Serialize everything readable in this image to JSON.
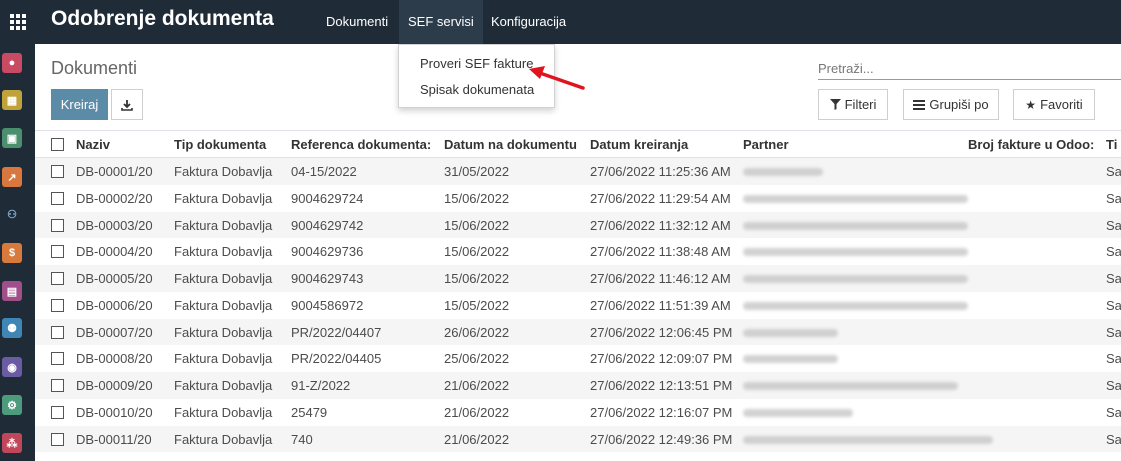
{
  "navbar": {
    "title": "Odobrenje dokumenta",
    "menu": [
      "Dokumenti",
      "SEF servisi",
      "Konfiguracija"
    ]
  },
  "dropdown": {
    "items": [
      "Proveri SEF fakture",
      "Spisak dokumenata"
    ]
  },
  "control_panel": {
    "breadcrumb": "Dokumenti",
    "create_label": "Kreiraj",
    "search_placeholder": "Pretraži...",
    "filters_label": "Filteri",
    "groupby_label": "Grupiši po",
    "favorites_label": "Favoriti"
  },
  "sidebar_icons": [
    "chat-icon",
    "calendar-icon",
    "contacts-icon",
    "chart-icon",
    "people-icon",
    "invoice-icon",
    "user-card-icon",
    "team-icon",
    "search-person-icon",
    "settings-user-icon",
    "network-icon"
  ],
  "table": {
    "columns": [
      "Naziv",
      "Tip dokumenta",
      "Referenca dokumenta:",
      "Datum na dokumentu",
      "Datum kreiranja",
      "Partner",
      "Broj fakture u Odoo:",
      "Ti"
    ],
    "rows": [
      [
        "DB-00001/20",
        "Faktura Dobavlja",
        "04-15/2022",
        "31/05/2022",
        "27/06/2022 11:25:36 AM",
        "Sa"
      ],
      [
        "DB-00002/20",
        "Faktura Dobavlja",
        "9004629724",
        "15/06/2022",
        "27/06/2022 11:29:54 AM",
        "Sa"
      ],
      [
        "DB-00003/20",
        "Faktura Dobavlja",
        "9004629742",
        "15/06/2022",
        "27/06/2022 11:32:12 AM",
        "Sa"
      ],
      [
        "DB-00004/20",
        "Faktura Dobavlja",
        "9004629736",
        "15/06/2022",
        "27/06/2022 11:38:48 AM",
        "Sa"
      ],
      [
        "DB-00005/20",
        "Faktura Dobavlja",
        "9004629743",
        "15/06/2022",
        "27/06/2022 11:46:12 AM",
        "Sa"
      ],
      [
        "DB-00006/20",
        "Faktura Dobavlja",
        "9004586972",
        "15/05/2022",
        "27/06/2022 11:51:39 AM",
        "Sa"
      ],
      [
        "DB-00007/20",
        "Faktura Dobavlja",
        "PR/2022/04407",
        "26/06/2022",
        "27/06/2022 12:06:45 PM",
        "Sa"
      ],
      [
        "DB-00008/20",
        "Faktura Dobavlja",
        "PR/2022/04405",
        "25/06/2022",
        "27/06/2022 12:09:07 PM",
        "Sa"
      ],
      [
        "DB-00009/20",
        "Faktura Dobavlja",
        "91-Z/2022",
        "21/06/2022",
        "27/06/2022 12:13:51 PM",
        "Sa"
      ],
      [
        "DB-00010/20",
        "Faktura Dobavlja",
        "25479",
        "21/06/2022",
        "27/06/2022 12:16:07 PM",
        "Sa"
      ],
      [
        "DB-00011/20",
        "Faktura Dobavlja",
        "740",
        "21/06/2022",
        "27/06/2022 12:49:36 PM",
        "Sa"
      ]
    ]
  },
  "colors": {
    "navbar_bg": "#1f2b37",
    "primary_button": "#5c8ba8",
    "arrow": "#e0141e"
  }
}
